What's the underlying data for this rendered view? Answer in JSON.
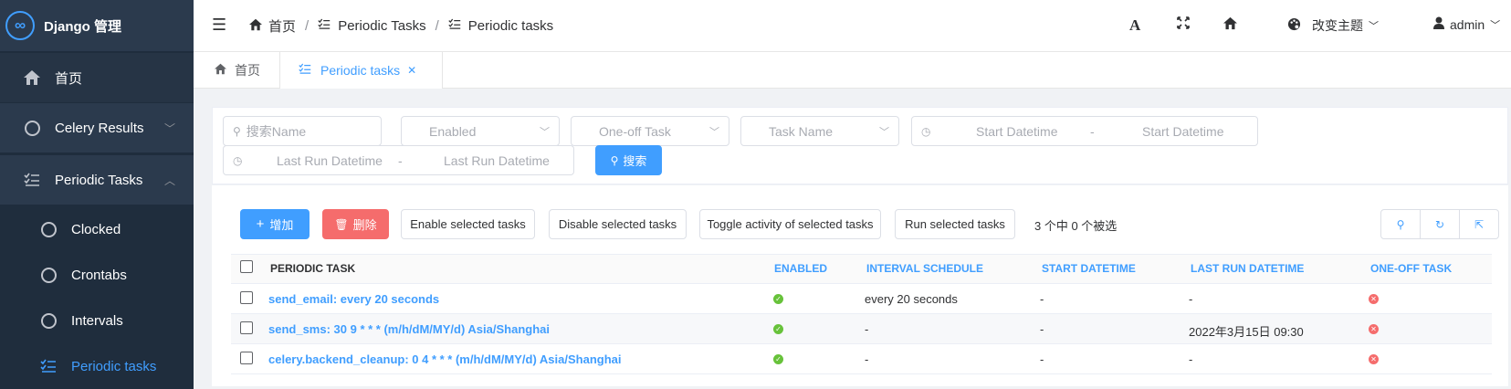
{
  "app": {
    "title": "Django 管理"
  },
  "sidebar": {
    "items": [
      {
        "label": "首页"
      },
      {
        "label": "Celery Results"
      },
      {
        "label": "Periodic Tasks"
      },
      {
        "label": "Clocked"
      },
      {
        "label": "Crontabs"
      },
      {
        "label": "Intervals"
      },
      {
        "label": "Periodic tasks"
      }
    ]
  },
  "header": {
    "breadcrumb": [
      "首页",
      "Periodic Tasks",
      "Periodic tasks"
    ],
    "font_glyph": "A",
    "theme_label": "改变主题",
    "user": "admin"
  },
  "tabs": [
    {
      "label": "首页"
    },
    {
      "label": "Periodic tasks"
    }
  ],
  "filters": {
    "search_placeholder": "搜索Name",
    "enabled": "Enabled",
    "oneoff": "One-off Task",
    "taskname": "Task Name",
    "start_from": "Start Datetime",
    "start_to": "Start Datetime",
    "dash": "-",
    "lastrun_from": "Last Run Datetime",
    "lastrun_to": "Last Run Datetime",
    "search_button": "搜索"
  },
  "actions": {
    "add": "增加",
    "delete": "删除",
    "enable": "Enable selected tasks",
    "disable": "Disable selected tasks",
    "toggle": "Toggle activity of selected tasks",
    "run": "Run selected tasks",
    "selection": "3 个中 0 个被选"
  },
  "table": {
    "columns": [
      "PERIODIC TASK",
      "ENABLED",
      "INTERVAL SCHEDULE",
      "START DATETIME",
      "LAST RUN DATETIME",
      "ONE-OFF TASK"
    ],
    "rows": [
      {
        "name": "send_email: every 20 seconds",
        "interval": "every 20 seconds",
        "start": "-",
        "last_run": "-",
        "enabled": true,
        "one_off": false
      },
      {
        "name": "send_sms: 30 9 * * * (m/h/dM/MY/d) Asia/Shanghai",
        "interval": "-",
        "start": "-",
        "last_run": "2022年3月15日 09:30",
        "enabled": true,
        "one_off": false
      },
      {
        "name": "celery.backend_cleanup: 0 4 * * * (m/h/dM/MY/d) Asia/Shanghai",
        "interval": "-",
        "start": "-",
        "last_run": "-",
        "enabled": true,
        "one_off": false
      }
    ]
  },
  "colors": {
    "accent": "#409eff",
    "sidebar": "#1f2d3d",
    "danger": "#f56c6c",
    "success": "#67c23a"
  }
}
